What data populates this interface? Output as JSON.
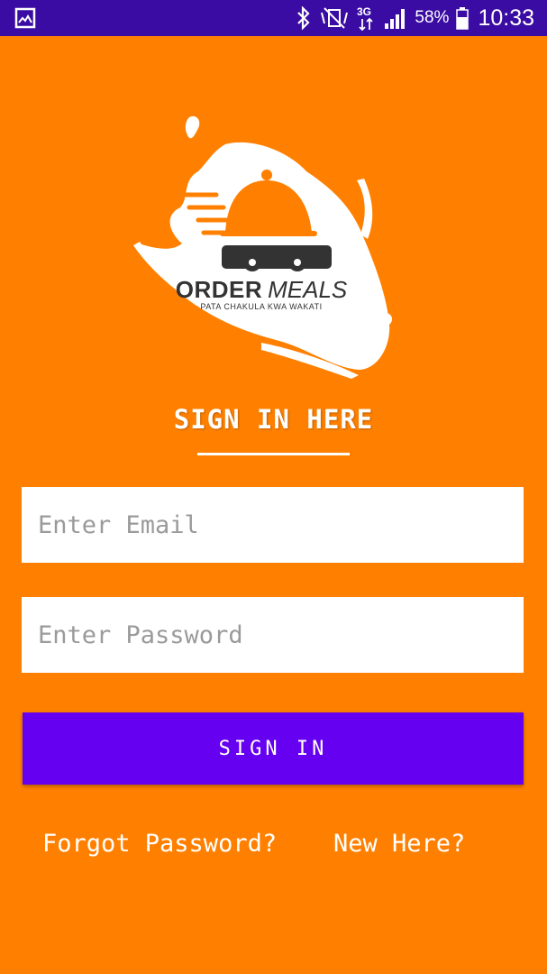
{
  "status_bar": {
    "battery_percent": "58%",
    "time": "10:33",
    "network": "3G",
    "icons": [
      "gallery-icon",
      "bluetooth-icon",
      "vibrate-icon",
      "signal-icon",
      "battery-icon"
    ]
  },
  "logo": {
    "brand_bold": "ORDER",
    "brand_light": "MEALS",
    "tagline": "PATA CHAKULA KWA WAKATI"
  },
  "login": {
    "heading": "SIGN IN HERE",
    "email_placeholder": "Enter Email",
    "password_placeholder": "Enter Password",
    "signin_label": "SIGN IN",
    "forgot_label": "Forgot Password?",
    "new_here_label": "New Here?"
  },
  "colors": {
    "background": "#FF8000",
    "status_bar": "#3A0CA3",
    "button": "#6600F0"
  }
}
